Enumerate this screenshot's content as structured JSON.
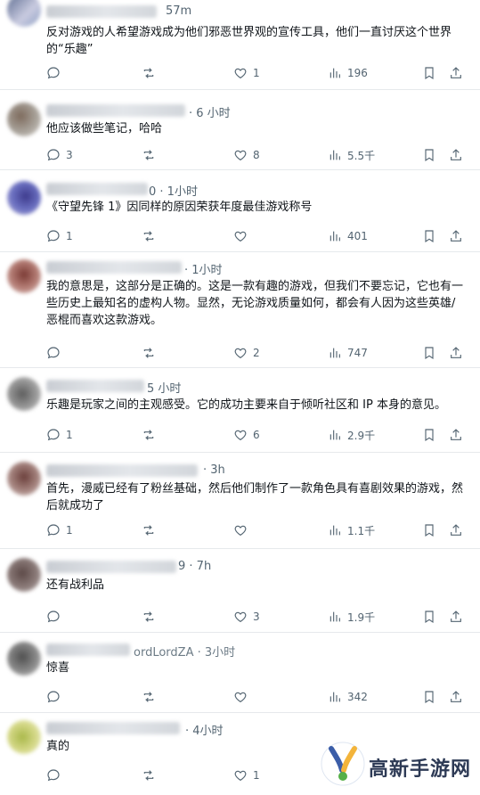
{
  "posts": [
    {
      "time": "57m",
      "text": "反对游戏的人希望游戏成为他们邪恶世界观的宣传工具，他们一直讨厌这个世界的“乐趣”",
      "replies": "",
      "retweets": "",
      "likes": "1",
      "views": "196"
    },
    {
      "time": "· 6 小时",
      "text": "他应该做些笔记，哈哈",
      "replies": "3",
      "retweets": "",
      "likes": "8",
      "views": "5.5千"
    },
    {
      "time": "0 · 1小时",
      "text": "《守望先锋 1》因同样的原因荣获年度最佳游戏称号",
      "replies": "1",
      "retweets": "",
      "likes": "",
      "views": "401"
    },
    {
      "time": "· 1小时",
      "text": "我的意思是，这部分是正确的。这是一款有趣的游戏，但我们不要忘记，它也有一些历史上最知名的虚构人物。显然，无论游戏质量如何，都会有人因为这些英雄/恶棍而喜欢这款游戏。",
      "replies": "",
      "retweets": "",
      "likes": "2",
      "views": "747"
    },
    {
      "time": "5 小时",
      "text": "乐趣是玩家之间的主观感受。它的成功主要来自于倾听社区和 IP 本身的意见。",
      "replies": "1",
      "retweets": "",
      "likes": "6",
      "views": "2.9千"
    },
    {
      "time": "· 3h",
      "text": "首先，漫威已经有了粉丝基础，然后他们制作了一款角色具有喜剧效果的游戏，然后就成功了",
      "replies": "1",
      "retweets": "",
      "likes": "",
      "views": "1.1千"
    },
    {
      "time": "9 · 7h",
      "text": "还有战利品",
      "replies": "",
      "retweets": "",
      "likes": "3",
      "views": "1.9千"
    },
    {
      "time": "ordLordZA · 3小时",
      "text": "惊喜",
      "replies": "",
      "retweets": "",
      "likes": "",
      "views": "342"
    },
    {
      "time": "· 4小时",
      "text": "真的",
      "replies": "",
      "retweets": "",
      "likes": "1",
      "views": ""
    }
  ],
  "watermark": {
    "text": "高新手游网"
  },
  "colors": {
    "icon": "#536471",
    "text": "#0f1419",
    "divider": "#e6e9ec"
  }
}
